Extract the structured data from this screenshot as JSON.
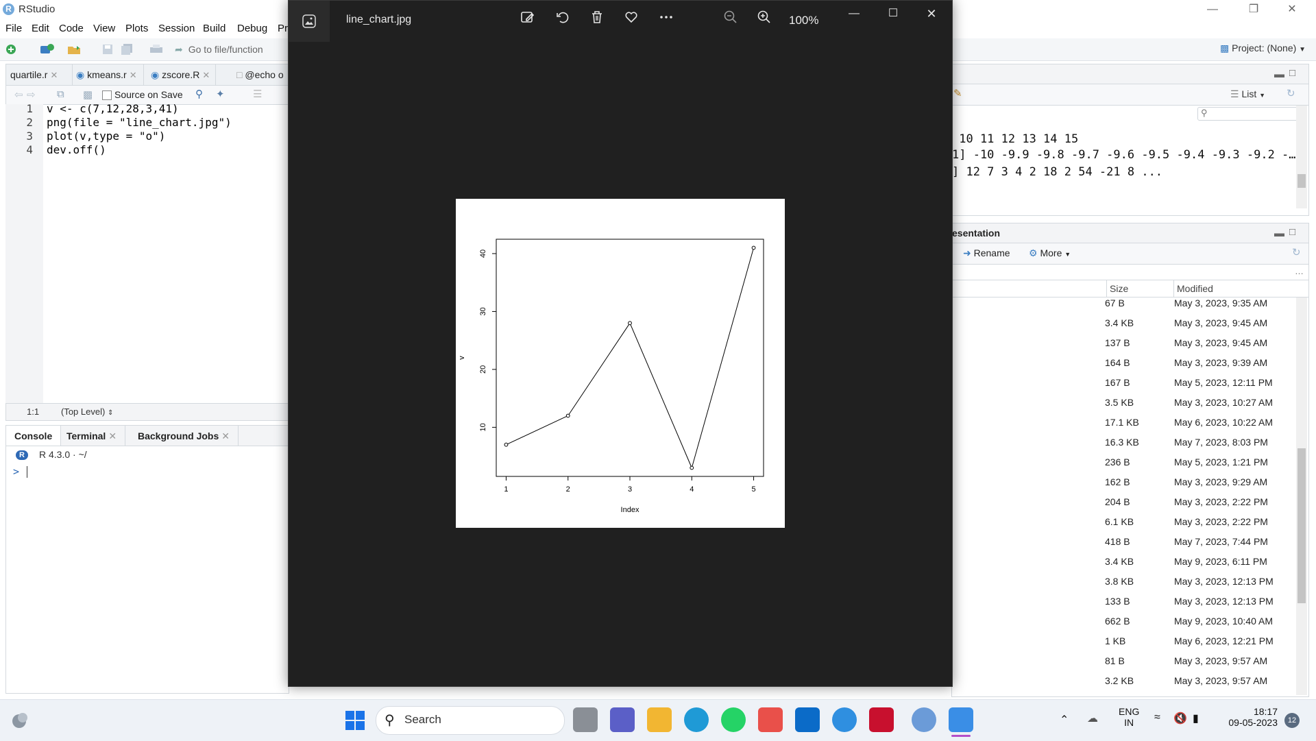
{
  "rstudio": {
    "app_title": "RStudio",
    "menus": [
      "File",
      "Edit",
      "Code",
      "View",
      "Plots",
      "Session",
      "Build",
      "Debug",
      "Pr"
    ],
    "goto_placeholder": "Go to file/function",
    "project_label": "Project: (None)",
    "editor_tabs": [
      "quartile.r",
      "kmeans.r",
      "zscore.R",
      "@echo o"
    ],
    "source_on_save": "Source on Save",
    "code_lines": [
      {
        "n": "1",
        "text": "v <- c(7,12,28,3,41)"
      },
      {
        "n": "2",
        "text": "png(file = \"line_chart.jpg\")"
      },
      {
        "n": "3",
        "text": "plot(v,type = \"o\")"
      },
      {
        "n": "4",
        "text": "dev.off()"
      }
    ],
    "cursor_pos": "1:1",
    "scope": "(Top Level)",
    "console_tabs": [
      "Console",
      "Terminal",
      "Background Jobs"
    ],
    "r_version": "R 4.3.0 · ~/",
    "prompt": ">",
    "env_view": "List",
    "env_lines": [
      " 10 11 12 13 14 15",
      "1] -10 -9.9 -9.8 -9.7 -9.6 -9.5 -9.4 -9.3 -9.2 -…",
      "] 12 7 3 4 2 18 2 54 -21 8 ..."
    ],
    "files_tab_fragment": "esentation",
    "files_actions": {
      "rename": "Rename",
      "more": "More"
    },
    "files_headers": {
      "size": "Size",
      "modified": "Modified"
    },
    "files_rows": [
      {
        "size": "67 B",
        "modified": "May 3, 2023, 9:35 AM"
      },
      {
        "size": "3.4 KB",
        "modified": "May 3, 2023, 9:45 AM"
      },
      {
        "size": "137 B",
        "modified": "May 3, 2023, 9:45 AM"
      },
      {
        "size": "164 B",
        "modified": "May 3, 2023, 9:39 AM"
      },
      {
        "size": "167 B",
        "modified": "May 5, 2023, 12:11 PM"
      },
      {
        "size": "3.5 KB",
        "modified": "May 3, 2023, 10:27 AM"
      },
      {
        "size": "17.1 KB",
        "modified": "May 6, 2023, 10:22 AM"
      },
      {
        "size": "16.3 KB",
        "modified": "May 7, 2023, 8:03 PM"
      },
      {
        "size": "236 B",
        "modified": "May 5, 2023, 1:21 PM"
      },
      {
        "size": "162 B",
        "modified": "May 3, 2023, 9:29 AM"
      },
      {
        "size": "204 B",
        "modified": "May 3, 2023, 2:22 PM"
      },
      {
        "size": "6.1 KB",
        "modified": "May 3, 2023, 2:22 PM"
      },
      {
        "size": "418 B",
        "modified": "May 7, 2023, 7:44 PM"
      },
      {
        "size": "3.4 KB",
        "modified": "May 9, 2023, 6:11 PM"
      },
      {
        "size": "3.8 KB",
        "modified": "May 3, 2023, 12:13 PM"
      },
      {
        "size": "133 B",
        "modified": "May 3, 2023, 12:13 PM"
      },
      {
        "size": "662 B",
        "modified": "May 9, 2023, 10:40 AM"
      },
      {
        "size": "1 KB",
        "modified": "May 6, 2023, 12:21 PM"
      },
      {
        "size": "81 B",
        "modified": "May 3, 2023, 9:57 AM"
      },
      {
        "size": "3.2 KB",
        "modified": "May 3, 2023, 9:57 AM"
      }
    ]
  },
  "viewer": {
    "filename": "line_chart.jpg",
    "zoom": "100%",
    "toolbar_icons": [
      "edit-icon",
      "rotate-icon",
      "delete-icon",
      "favorite-icon",
      "more-icon",
      "zoom-out-icon",
      "zoom-in-icon"
    ]
  },
  "chart_data": {
    "type": "line",
    "x": [
      1,
      2,
      3,
      4,
      5
    ],
    "values": [
      7,
      12,
      28,
      3,
      41
    ],
    "xlabel": "Index",
    "ylabel": "v",
    "xticks": [
      "1",
      "2",
      "3",
      "4",
      "5"
    ],
    "yticks": [
      "10",
      "20",
      "30",
      "40"
    ],
    "xlim": [
      0.84,
      5.16
    ],
    "ylim": [
      1.52,
      42.48
    ],
    "markers": "open-circle",
    "grid": false
  },
  "taskbar": {
    "search_label": "Search",
    "lang": "ENG",
    "region": "IN",
    "time": "18:17",
    "date": "09-05-2023",
    "notifications": "12",
    "apps": [
      "start-icon",
      "task-view-icon",
      "teams-icon",
      "file-explorer-icon",
      "edge-icon",
      "whatsapp-icon",
      "store-icon",
      "myhp-icon",
      "help-icon",
      "mcafee-icon",
      "r-app-icon",
      "photos-icon"
    ]
  }
}
